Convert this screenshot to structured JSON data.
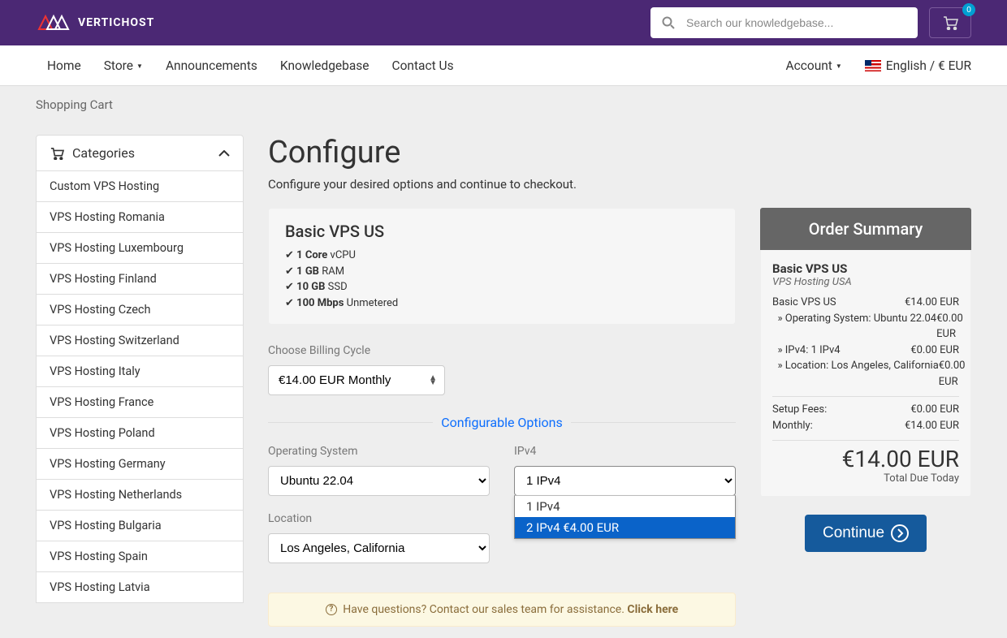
{
  "brand": "VERTICHOST",
  "search": {
    "placeholder": "Search our knowledgebase..."
  },
  "cart_count": "0",
  "nav": {
    "items": [
      "Home",
      "Store",
      "Announcements",
      "Knowledgebase",
      "Contact Us"
    ],
    "account": "Account",
    "language": "English / € EUR"
  },
  "breadcrumb": "Shopping Cart",
  "categories": {
    "title": "Categories",
    "items": [
      "Custom VPS Hosting",
      "VPS Hosting Romania",
      "VPS Hosting Luxembourg",
      "VPS Hosting Finland",
      "VPS Hosting Czech",
      "VPS Hosting Switzerland",
      "VPS Hosting Italy",
      "VPS Hosting France",
      "VPS Hosting Poland",
      "VPS Hosting Germany",
      "VPS Hosting Netherlands",
      "VPS Hosting Bulgaria",
      "VPS Hosting Spain",
      "VPS Hosting Latvia"
    ]
  },
  "page": {
    "title": "Configure",
    "subtitle": "Configure your desired options and continue to checkout."
  },
  "product": {
    "name": "Basic VPS US",
    "specs": [
      {
        "b": "1 Core",
        "r": " vCPU"
      },
      {
        "b": "1 GB",
        "r": " RAM"
      },
      {
        "b": "10 GB",
        "r": " SSD"
      },
      {
        "b": "100 Mbps",
        "r": " Unmetered"
      }
    ]
  },
  "billing": {
    "label": "Choose Billing Cycle",
    "value": "€14.00 EUR Monthly"
  },
  "config_section": "Configurable Options",
  "opts": {
    "os": {
      "label": "Operating System",
      "value": "Ubuntu 22.04"
    },
    "ipv4": {
      "label": "IPv4",
      "value": "1 IPv4",
      "options": [
        "1 IPv4",
        "2 IPv4 €4.00 EUR"
      ]
    },
    "location": {
      "label": "Location",
      "value": "Los Angeles, California"
    }
  },
  "help": {
    "text": "Have questions? Contact our sales team for assistance. ",
    "cta": "Click here"
  },
  "summary": {
    "title": "Order Summary",
    "product": "Basic VPS US",
    "category": "VPS Hosting USA",
    "lines": [
      {
        "l": "Basic VPS US",
        "r": "€14.00 EUR"
      },
      {
        "l": "  » Operating System: Ubuntu 22.04",
        "r": "€0.00 EUR"
      },
      {
        "l": "  » IPv4: 1 IPv4",
        "r": "€0.00 EUR"
      },
      {
        "l": "  » Location: Los Angeles, California",
        "r": "€0.00 EUR"
      }
    ],
    "fees": [
      {
        "l": "Setup Fees:",
        "r": "€0.00 EUR"
      },
      {
        "l": "Monthly:",
        "r": "€14.00 EUR"
      }
    ],
    "total": "€14.00 EUR",
    "due_label": "Total Due Today",
    "continue": "Continue"
  }
}
